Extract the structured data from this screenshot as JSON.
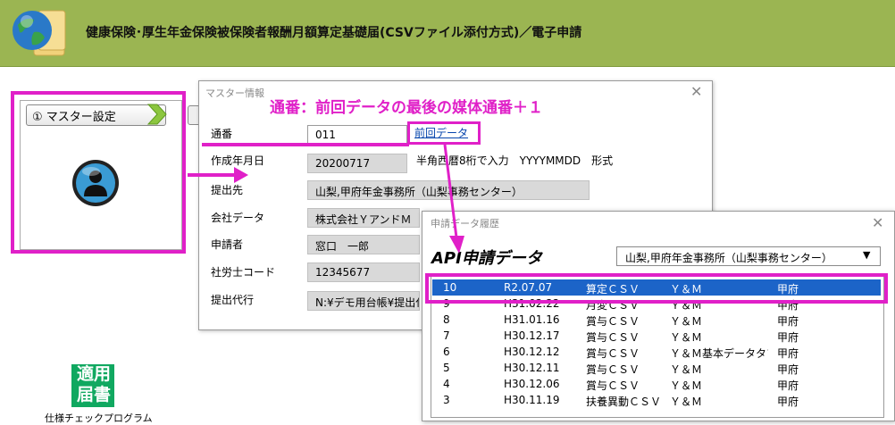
{
  "app": {
    "title": "健康保険･厚生年金保険被保険者報酬月額算定基礎届(CSVファイル添付方式)／電子申請"
  },
  "card": {
    "tab_label": "① マスター設定"
  },
  "master": {
    "window_title": "マスター情報",
    "close": "✕",
    "fields": [
      {
        "label": "通番",
        "value": "011"
      },
      {
        "label": "作成年月日",
        "value": "20200717"
      },
      {
        "label": "提出先",
        "value": "山梨,甲府年金事務所（山梨事務センター）"
      },
      {
        "label": "会社データ",
        "value": "株式会社ＹアンドＭ"
      },
      {
        "label": "申請者",
        "value": "窓口　一郎"
      },
      {
        "label": "社労士コード",
        "value": "12345677"
      },
      {
        "label": "提出代行",
        "value": "N:¥デモ用台帳¥提出代"
      }
    ],
    "prev_data_link": "前回データ",
    "date_hint": "半角西暦8桁で入力　YYYYMMDD　形式"
  },
  "annotation": {
    "text": "通番：前回データの最後の媒体通番＋１"
  },
  "history": {
    "window_title": "申請データ履歴",
    "close": "✕",
    "heading": "API申請データ",
    "office_select": "山梨,甲府年金事務所（山梨事務センター）",
    "rows": [
      {
        "no": "10",
        "date": "R2.07.07",
        "type": "算定ＣＳＶ",
        "company": "Ｙ＆Ｍ",
        "office": "甲府"
      },
      {
        "no": "9",
        "date": "H31.02.22",
        "type": "月変ＣＳＶ",
        "company": "Ｙ＆Ｍ",
        "office": "甲府"
      },
      {
        "no": "8",
        "date": "H31.01.16",
        "type": "賞与ＣＳＶ",
        "company": "Ｙ＆Ｍ",
        "office": "甲府"
      },
      {
        "no": "7",
        "date": "H30.12.17",
        "type": "賞与ＣＳＶ",
        "company": "Ｙ＆Ｍ",
        "office": "甲府"
      },
      {
        "no": "6",
        "date": "H30.12.12",
        "type": "賞与ＣＳＶ",
        "company": "Ｙ＆Ｍ基本データタブ",
        "office": "甲府"
      },
      {
        "no": "5",
        "date": "H30.12.11",
        "type": "賞与ＣＳＶ",
        "company": "Ｙ＆Ｍ",
        "office": "甲府"
      },
      {
        "no": "4",
        "date": "H30.12.06",
        "type": "賞与ＣＳＶ",
        "company": "Ｙ＆Ｍ",
        "office": "甲府"
      },
      {
        "no": "3",
        "date": "H30.11.19",
        "type": "扶養異動ＣＳＶ",
        "company": "Ｙ＆Ｍ",
        "office": "甲府"
      }
    ]
  },
  "app_icon": {
    "text_line1": "適用",
    "text_line2": "届書",
    "caption": "仕様チェックプログラム"
  },
  "colors": {
    "header": "#9bb552",
    "annotation": "#e020c8",
    "selection": "#1c64c8"
  }
}
